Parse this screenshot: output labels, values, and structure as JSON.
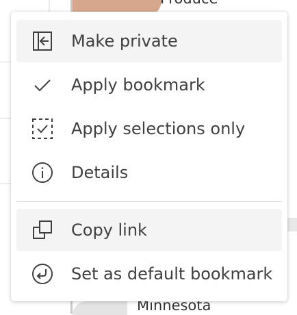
{
  "background": {
    "top_text": "Produce",
    "bottom_text": "Minnesota"
  },
  "menu": {
    "items": [
      {
        "label": "Make private",
        "icon": "make-private-icon"
      },
      {
        "label": "Apply bookmark",
        "icon": "checkmark-icon"
      },
      {
        "label": "Apply selections only",
        "icon": "dashed-check-icon"
      },
      {
        "label": "Details",
        "icon": "info-icon"
      },
      {
        "label": "Copy link",
        "icon": "copy-link-icon"
      },
      {
        "label": "Set as default bookmark",
        "icon": "set-default-icon"
      }
    ]
  },
  "colors": {
    "text": "#404040",
    "highlight": "#f4f4f4",
    "divider": "#d9d9d9"
  }
}
